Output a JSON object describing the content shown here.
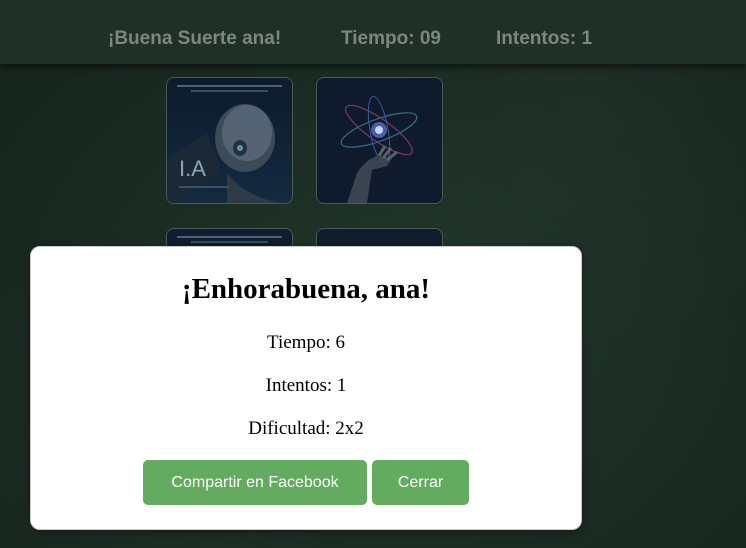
{
  "header": {
    "greeting": "¡Buena Suerte ana!",
    "timer": "Tiempo: 09",
    "attempts": "Intentos: 1"
  },
  "cards": [
    {
      "image": "robot-ai-poster",
      "caption": "I.A"
    },
    {
      "image": "robot-hand-atom"
    },
    {
      "image": "robot-ai-poster"
    },
    {
      "image": "hidden"
    }
  ],
  "modal": {
    "title": "¡Enhorabuena, ana!",
    "time": "Tiempo: 6",
    "attempts": "Intentos: 1",
    "difficulty": "Dificultad: 2x2",
    "share_label": "Compartir en Facebook",
    "close_label": "Cerrar"
  },
  "colors": {
    "background": "#1b2d24",
    "header": "#1f3026",
    "header_text": "#7d8680",
    "button": "#63ab5f"
  }
}
